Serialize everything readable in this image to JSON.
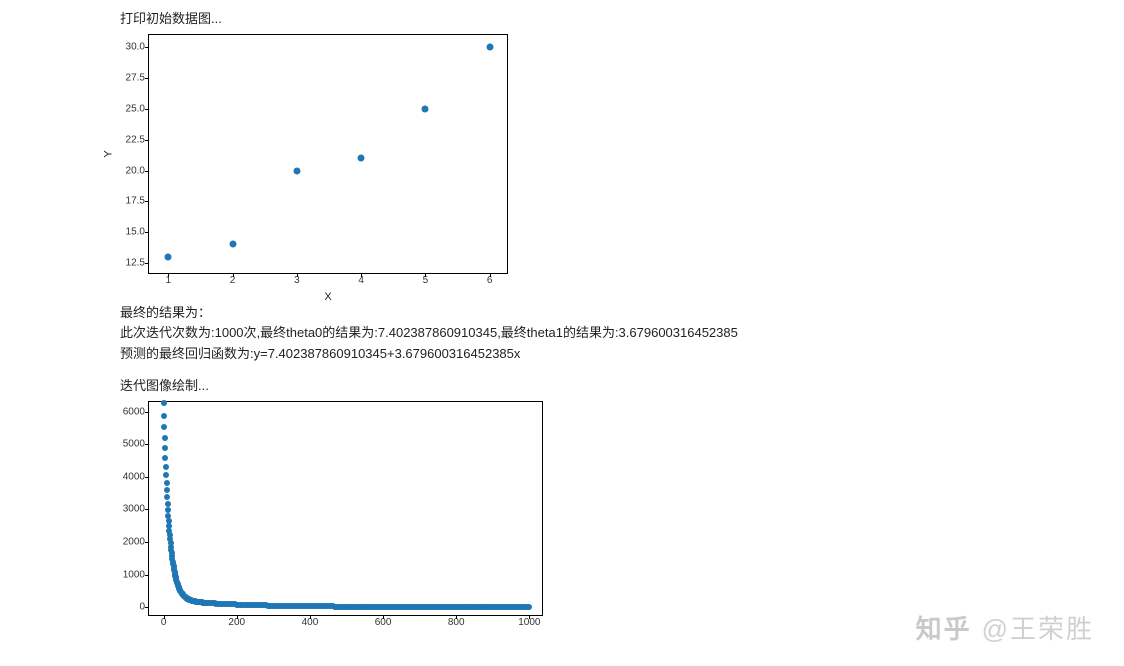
{
  "text": {
    "line1": "打印初始数据图...",
    "result_header": "最终的结果为：",
    "result_line1": "此次迭代次数为:1000次,最终theta0的结果为:7.402387860910345,最终theta1的结果为:3.679600316452385",
    "result_line2": "预测的最终回归函数为:y=7.402387860910345+3.679600316452385x",
    "iter_header": "迭代图像绘制..."
  },
  "watermark": {
    "brand": "知乎",
    "at": "@王荣胜"
  },
  "chart_data": [
    {
      "type": "scatter",
      "title": "",
      "xlabel": "X",
      "ylabel": "Y",
      "x": [
        1,
        2,
        3,
        4,
        5,
        6
      ],
      "y": [
        13,
        14,
        20,
        21,
        25,
        30
      ],
      "xticks": [
        1,
        2,
        3,
        4,
        5,
        6
      ],
      "yticks": [
        12.5,
        15.0,
        17.5,
        20.0,
        22.5,
        25.0,
        27.5,
        30.0
      ],
      "xlim": [
        0.7,
        6.3
      ],
      "ylim": [
        11.5,
        31.0
      ]
    },
    {
      "type": "scatter",
      "title": "",
      "xlabel": "",
      "ylabel": "",
      "description": "Loss/cost vs iteration (1000 iterations). Rapid decay from ~6000 to near 0.",
      "xticks": [
        0,
        200,
        400,
        600,
        800,
        1000
      ],
      "yticks": [
        0,
        1000,
        2000,
        3000,
        4000,
        5000,
        6000
      ],
      "xlim": [
        -40,
        1040
      ],
      "ylim": [
        -300,
        6300
      ],
      "sample_points": [
        {
          "x": 0,
          "y": 6000
        },
        {
          "x": 5,
          "y": 4400
        },
        {
          "x": 10,
          "y": 3200
        },
        {
          "x": 15,
          "y": 2400
        },
        {
          "x": 20,
          "y": 1800
        },
        {
          "x": 25,
          "y": 1400
        },
        {
          "x": 30,
          "y": 1050
        },
        {
          "x": 35,
          "y": 800
        },
        {
          "x": 40,
          "y": 620
        },
        {
          "x": 50,
          "y": 420
        },
        {
          "x": 60,
          "y": 300
        },
        {
          "x": 80,
          "y": 190
        },
        {
          "x": 100,
          "y": 130
        },
        {
          "x": 150,
          "y": 80
        },
        {
          "x": 200,
          "y": 55
        },
        {
          "x": 300,
          "y": 35
        },
        {
          "x": 400,
          "y": 25
        },
        {
          "x": 500,
          "y": 20
        },
        {
          "x": 600,
          "y": 15
        },
        {
          "x": 700,
          "y": 12
        },
        {
          "x": 800,
          "y": 10
        },
        {
          "x": 900,
          "y": 8
        },
        {
          "x": 1000,
          "y": 7
        }
      ]
    }
  ]
}
